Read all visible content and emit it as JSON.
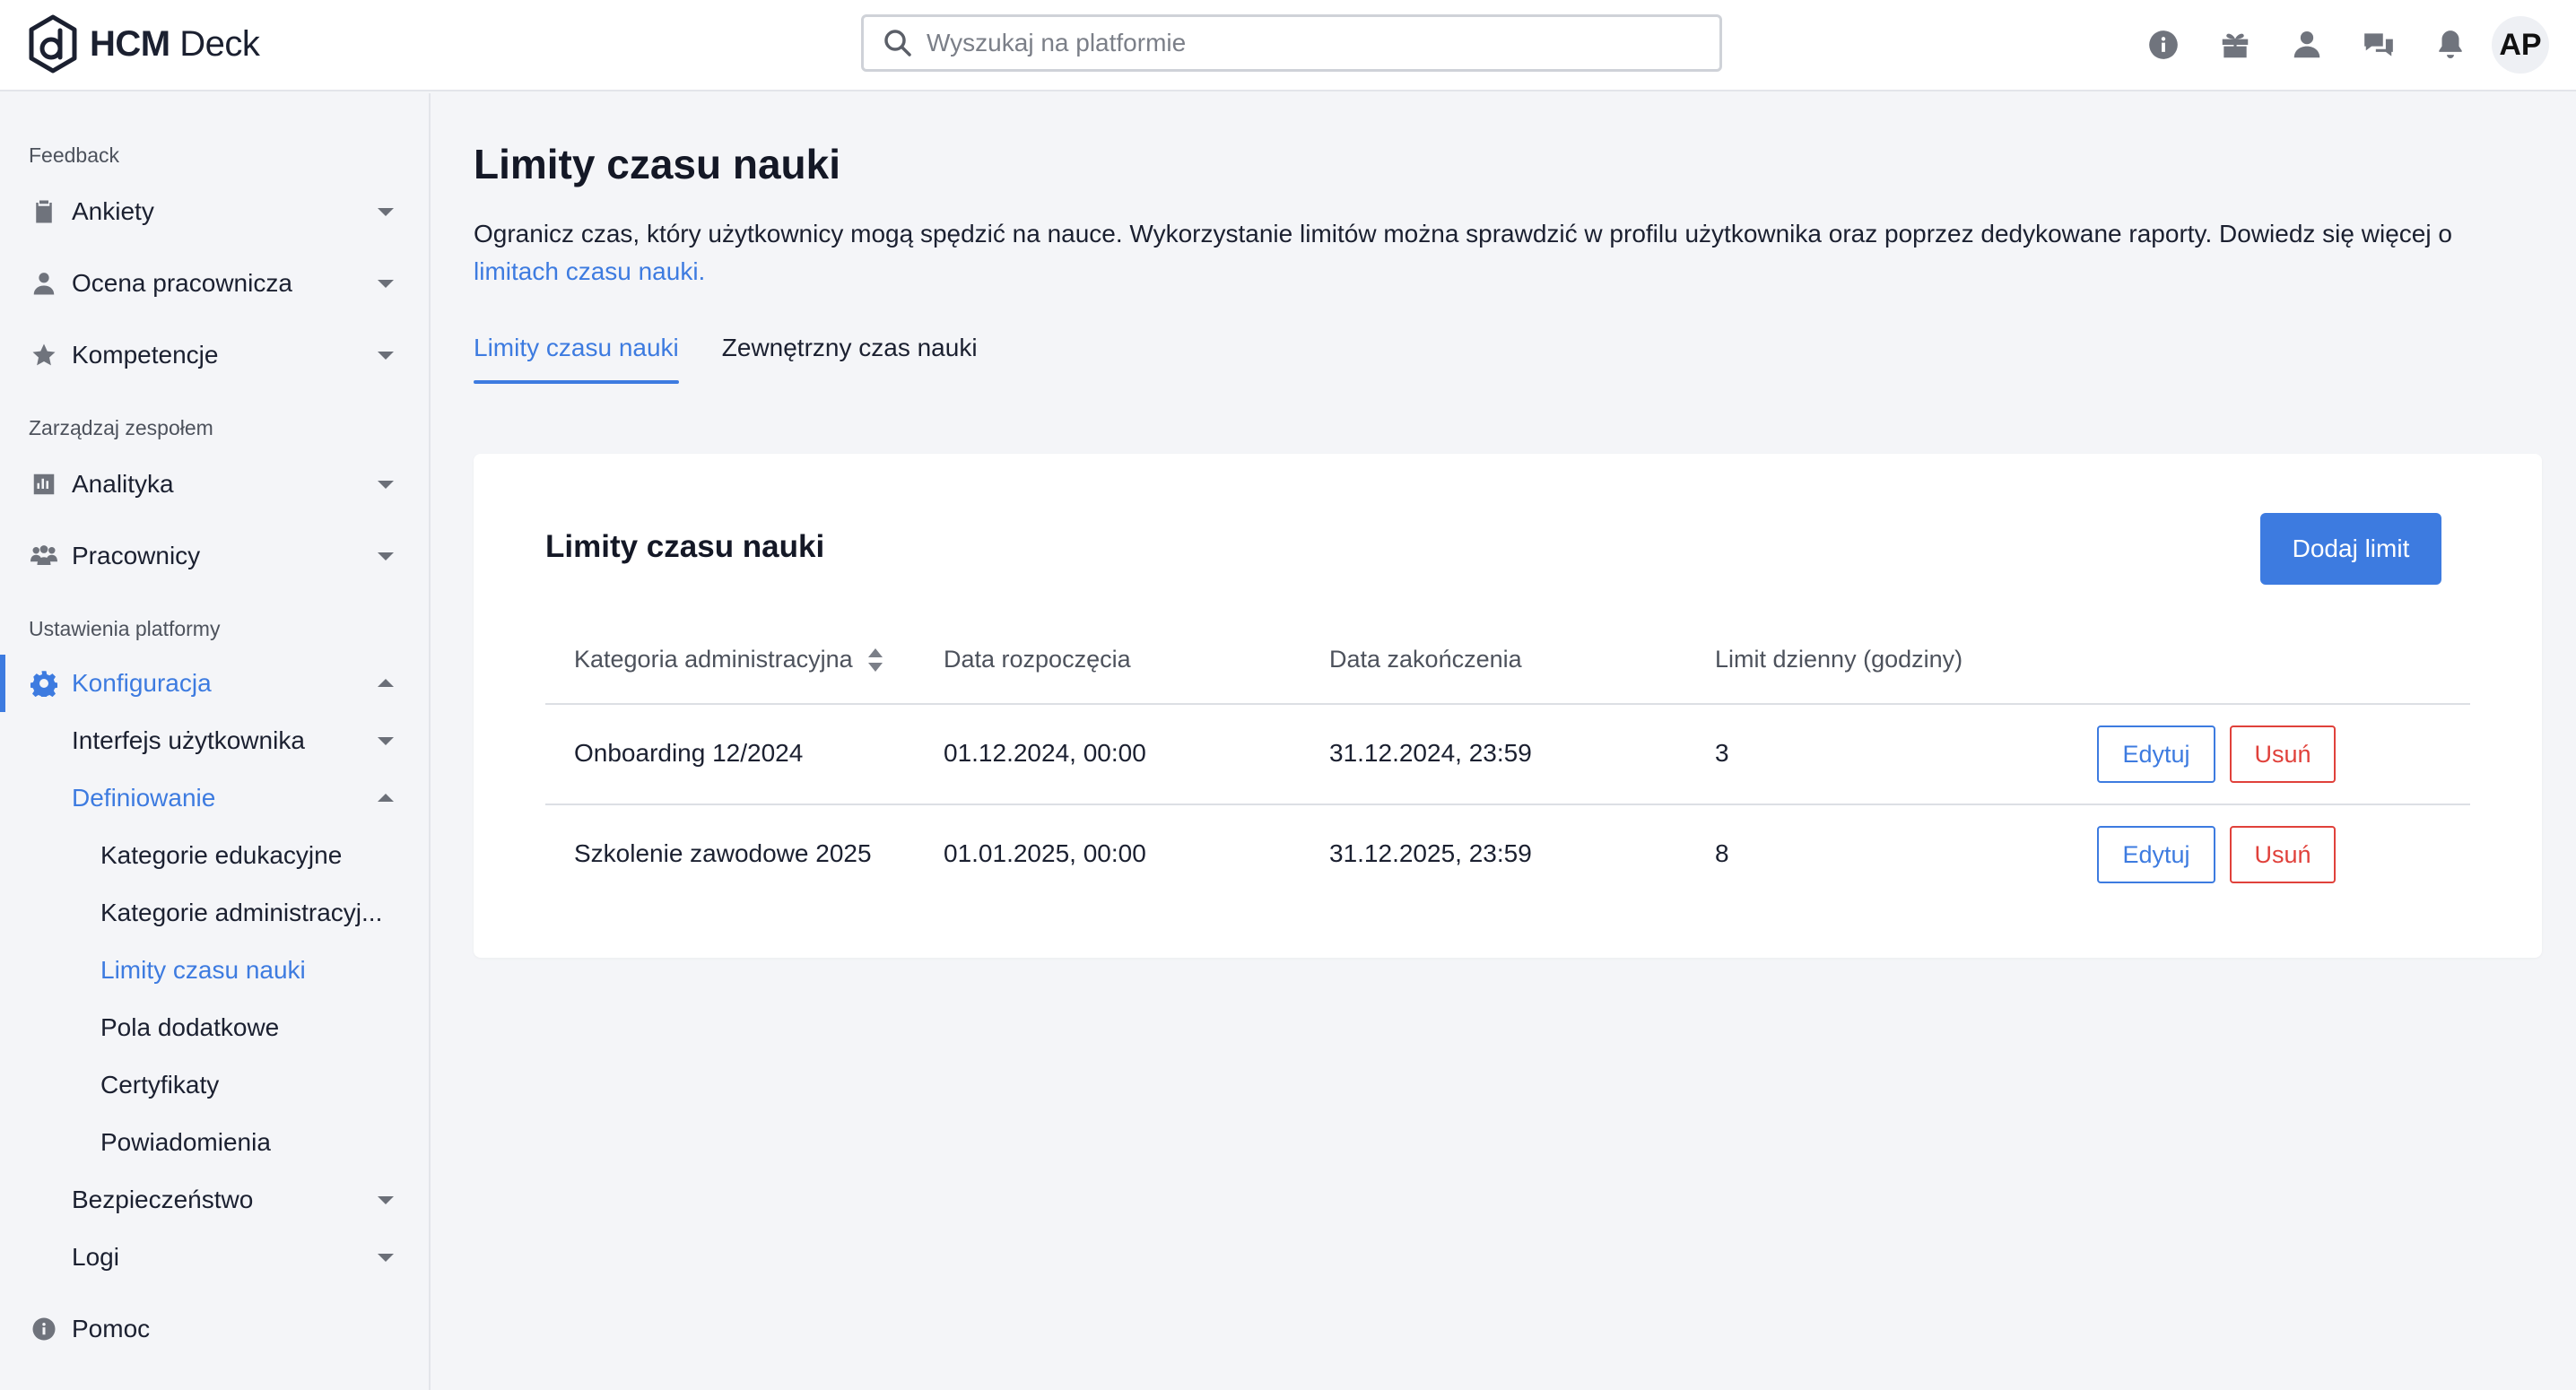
{
  "header": {
    "logo_bold": "HCM",
    "logo_light": " Deck",
    "search_placeholder": "Wyszukaj na platformie",
    "avatar_initials": "AP"
  },
  "sidebar": {
    "sections": {
      "feedback": "Feedback",
      "team": "Zarządzaj zespołem",
      "platform": "Ustawienia platformy"
    },
    "items": {
      "ankiety": "Ankiety",
      "ocena": "Ocena pracownicza",
      "kompetencje": "Kompetencje",
      "analityka": "Analityka",
      "pracownicy": "Pracownicy",
      "konfiguracja": "Konfiguracja",
      "interfejs": "Interfejs użytkownika",
      "definiowanie": "Definiowanie",
      "kat_edu": "Kategorie edukacyjne",
      "kat_adm": "Kategorie administracyj...",
      "limity": "Limity czasu nauki",
      "pola": "Pola dodatkowe",
      "certyfikaty": "Certyfikaty",
      "powiadomienia": "Powiadomienia",
      "bezpieczenstwo": "Bezpieczeństwo",
      "logi": "Logi",
      "pomoc": "Pomoc"
    }
  },
  "main": {
    "title": "Limity czasu nauki",
    "description": "Ogranicz czas, który użytkownicy mogą spędzić na nauce. Wykorzystanie limitów można sprawdzić w profilu użytkownika oraz poprzez dedykowane raporty. Dowiedz się więcej o ",
    "description_link": "limitach czasu nauki.",
    "tabs": [
      "Limity czasu nauki",
      "Zewnętrzny czas nauki"
    ],
    "card": {
      "title": "Limity czasu nauki",
      "add_button": "Dodaj limit",
      "columns": [
        "Kategoria administracyjna",
        "Data rozpoczęcia",
        "Data zakończenia",
        "Limit dzienny (godziny)"
      ],
      "rows": [
        {
          "category": "Onboarding 12/2024",
          "start": "01.12.2024, 00:00",
          "end": "31.12.2024, 23:59",
          "limit": "3"
        },
        {
          "category": "Szkolenie zawodowe 2025",
          "start": "01.01.2025, 00:00",
          "end": "31.12.2025, 23:59",
          "limit": "8"
        }
      ],
      "edit_label": "Edytuj",
      "delete_label": "Usuń"
    }
  },
  "colors": {
    "accent": "#3d7be0",
    "danger": "#e0413b",
    "background": "#f4f5f8"
  }
}
